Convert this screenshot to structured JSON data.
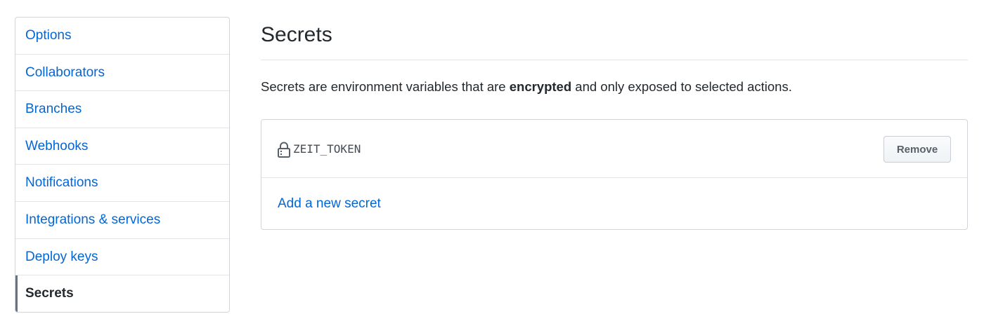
{
  "sidebar": {
    "items": [
      {
        "label": "Options"
      },
      {
        "label": "Collaborators"
      },
      {
        "label": "Branches"
      },
      {
        "label": "Webhooks"
      },
      {
        "label": "Notifications"
      },
      {
        "label": "Integrations & services"
      },
      {
        "label": "Deploy keys"
      },
      {
        "label": "Secrets",
        "selected": true
      }
    ]
  },
  "main": {
    "title": "Secrets",
    "description": {
      "before": "Secrets are environment variables that are ",
      "emphasis": "encrypted",
      "after": " and only exposed to selected actions."
    },
    "secrets": [
      {
        "name": "ZEIT_TOKEN",
        "icon": "lock-icon",
        "remove_label": "Remove"
      }
    ],
    "add_secret_label": "Add a new secret"
  },
  "colors": {
    "link": "#0366d6",
    "text": "#24292e",
    "border": "#d1d5da",
    "selected_indicator": "#6a737d"
  }
}
